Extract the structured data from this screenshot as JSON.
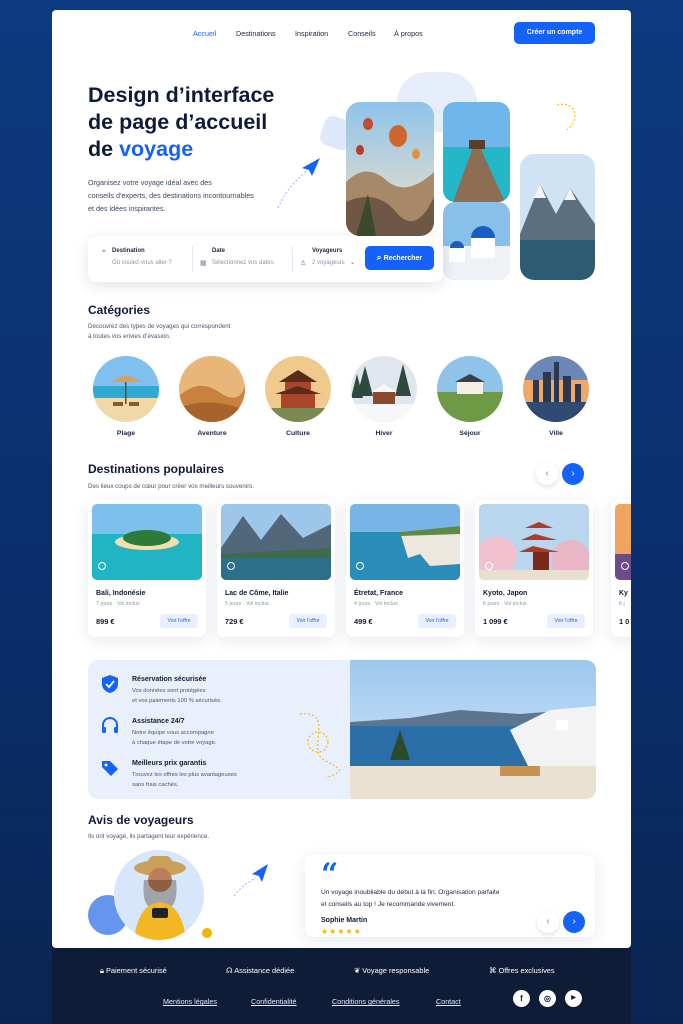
{
  "nav": {
    "items": [
      "Accueil",
      "Destinations",
      "Inspiration",
      "Conseils",
      "À propos"
    ],
    "cta": "Créer un compte"
  },
  "hero": {
    "title_l1": "Design d’interface",
    "title_l2": "de page d’accueil",
    "title_l3a": "de ",
    "title_l3b": "voyage",
    "desc_l1": "Organisez votre voyage idéal avec des",
    "desc_l2": "conseils d’experts, des destinations incontournables",
    "desc_l3": "et des idées inspirantes."
  },
  "search": {
    "dest_label": "Destination",
    "dest_ph": "Où voulez-vous aller ?",
    "date_label": "Date",
    "date_ph": "Sélectionnez vos dates",
    "trav_label": "Voyageurs",
    "trav_value": "2 voyageurs",
    "button": "Rechercher"
  },
  "categories": {
    "title": "Catégories",
    "sub_l1": "Découvrez des types de voyages qui correspondent",
    "sub_l2": "à toutes vos envies d’évasion.",
    "items": [
      "Plage",
      "Aventure",
      "Culture",
      "Hiver",
      "Séjour",
      "Ville"
    ]
  },
  "popular": {
    "title": "Destinations populaires",
    "sub": "Des lieux coups de cœur pour créer vos meilleurs souvenirs.",
    "cards": [
      {
        "name": "Bali, Indonésie",
        "info": "7 jours · Vol inclus",
        "price": "899 €",
        "btn": "Voir l’offre"
      },
      {
        "name": "Lac de Côme, Italie",
        "info": "5 jours · Vol inclus",
        "price": "729 €",
        "btn": "Voir l’offre"
      },
      {
        "name": "Étretat, France",
        "info": "4 jours · Vol inclus",
        "price": "499 €",
        "btn": "Voir l’offre"
      },
      {
        "name": "Kyoto, Japon",
        "info": "6 jours · Vol inclus",
        "price": "1 099 €",
        "btn": "Voir l’offre"
      },
      {
        "name": "Ky",
        "info": "6 j",
        "price": "1 0",
        "btn": ""
      }
    ]
  },
  "features": [
    {
      "title": "Réservation sécurisée",
      "l1": "Vos données sont protégées",
      "l2": "et vos paiements 100 % sécurisés."
    },
    {
      "title": "Assistance 24/7",
      "l1": "Notre équipe vous accompagne",
      "l2": "à chaque étape de votre voyage."
    },
    {
      "title": "Meilleurs prix garantis",
      "l1": "Trouvez les offres les plus avantageuses",
      "l2": "sans frais cachés."
    }
  ],
  "reviews": {
    "title": "Avis de voyageurs",
    "sub": "Ils ont voyagé, ils partagent leur expérience.",
    "quote_l1": "Un voyage inoubliable du début à la fin. Organisation parfaite",
    "quote_l2": "et conseils au top ! Je recommande vivement.",
    "author": "Sophie Martin",
    "stars": "★★★★★",
    "rating": 5
  },
  "footer": {
    "items": [
      "Paiement sécurisé",
      "Assistance dédiée",
      "Voyage responsable",
      "Offres exclusives"
    ],
    "links": [
      "Mentions légales",
      "Confidentialité",
      "Conditions générales",
      "Contact"
    ],
    "social": [
      "f",
      "◎",
      "▶"
    ]
  },
  "colors": {
    "accent": "#1462f7",
    "dark": "#0f1c38",
    "star": "#f5b301"
  }
}
